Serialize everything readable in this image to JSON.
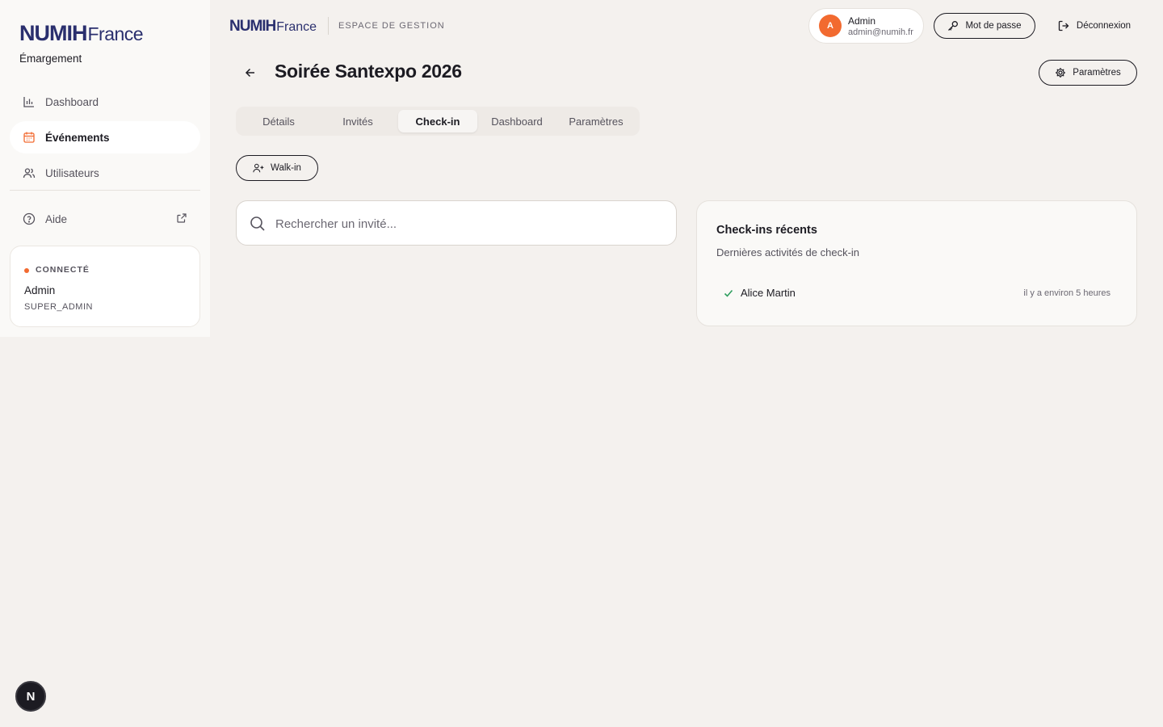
{
  "brand": {
    "name_bold": "NUMIH",
    "name_light": "France",
    "subtitle": "Émargement"
  },
  "sidebar": {
    "items": [
      {
        "label": "Dashboard",
        "icon": "bar-chart-icon",
        "active": false
      },
      {
        "label": "Événements",
        "icon": "calendar-icon",
        "active": true
      },
      {
        "label": "Utilisateurs",
        "icon": "users-icon",
        "active": false
      },
      {
        "label": "Aide",
        "icon": "help-circle-icon",
        "active": false
      }
    ],
    "status": {
      "label": "CONNECTÉ",
      "name": "Admin",
      "role": "SUPER_ADMIN"
    }
  },
  "header": {
    "logo_bold": "NUMIH",
    "logo_light": "France",
    "space_label": "ESPACE DE GESTION",
    "user": {
      "initial": "A",
      "name": "Admin",
      "email": "admin@numih.fr"
    },
    "password_label": "Mot de passe",
    "logout_label": "Déconnexion"
  },
  "page": {
    "title": "Soirée Santexpo 2026",
    "settings_label": "Paramètres",
    "tabs": [
      {
        "label": "Détails",
        "active": false
      },
      {
        "label": "Invités",
        "active": false
      },
      {
        "label": "Check-in",
        "active": true
      },
      {
        "label": "Dashboard",
        "active": false
      },
      {
        "label": "Paramètres",
        "active": false
      }
    ],
    "walkin_label": "Walk-in",
    "search": {
      "placeholder": "Rechercher un invité...",
      "value": ""
    },
    "recent": {
      "title": "Check-ins récents",
      "subtitle": "Dernières activités de check-in",
      "items": [
        {
          "name": "Alice Martin",
          "time": "il y a environ 5 heures"
        }
      ]
    }
  },
  "floating": {
    "label": "N"
  },
  "colors": {
    "accent": "#f26a30",
    "brand": "#2a2f6e",
    "text": "#1c1b22",
    "background": "#f4f1ee"
  }
}
